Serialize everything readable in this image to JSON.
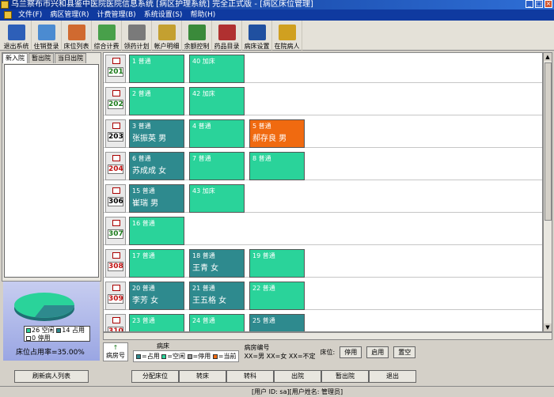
{
  "window": {
    "title": "乌兰察布市兴和县鉴中医院医院信息系统 [病区护理系统] 完全正式版 - [病区床位管理]"
  },
  "menu": {
    "items": [
      "文件(F)",
      "病区管理(R)",
      "计费管理(B)",
      "系统设置(S)",
      "帮助(H)"
    ]
  },
  "toolbar": {
    "items": [
      {
        "label": "退出系统",
        "icon": "exit-icon",
        "color": "#2d5fb8"
      },
      {
        "label": "住销登录",
        "icon": "login-icon",
        "color": "#4b8bd1"
      },
      {
        "label": "床位列表",
        "icon": "users-icon",
        "color": "#d06a30"
      },
      {
        "label": "综合计费",
        "icon": "chart-icon",
        "color": "#48a04a"
      },
      {
        "label": "领药计划",
        "icon": "clipboard-icon",
        "color": "#7a7a7a"
      },
      {
        "label": "帐户明细",
        "icon": "magnifier-icon",
        "color": "#c4a030"
      },
      {
        "label": "余额控制",
        "icon": "checklist-icon",
        "color": "#3a8a3a"
      },
      {
        "label": "药品目录",
        "icon": "books-icon",
        "color": "#b03030"
      },
      {
        "label": "病床设置",
        "icon": "monitor-icon",
        "color": "#2050a0"
      },
      {
        "label": "在院病人",
        "icon": "bars-icon",
        "color": "#d0a020"
      }
    ]
  },
  "leftpanel": {
    "tabs": [
      "新入院",
      "暂出院",
      "当日出院"
    ],
    "legend": {
      "empty": "26 空闲",
      "occupied": "14 占用",
      "disabled": "0 停用"
    },
    "rate_label": "床位占用率=35.00%"
  },
  "colors": {
    "occupied": "#2e8a8e",
    "empty": "#2ad39a",
    "current": "#f06a10",
    "disabled": "#9a9a9a"
  },
  "rooms": [
    {
      "num": "201",
      "num_color": "#1a7a1a",
      "beds": [
        {
          "no": "1 普通",
          "name": "",
          "status": "empty"
        },
        {
          "no": "40 加床",
          "name": "",
          "status": "empty"
        }
      ]
    },
    {
      "num": "202",
      "num_color": "#1a7a1a",
      "beds": [
        {
          "no": "2 普通",
          "name": "",
          "status": "empty"
        },
        {
          "no": "42 加床",
          "name": "",
          "status": "empty"
        }
      ]
    },
    {
      "num": "203",
      "num_color": "#000000",
      "beds": [
        {
          "no": "3 普通",
          "name": "张振英 男",
          "status": "occupied"
        },
        {
          "no": "4 普通",
          "name": "",
          "status": "empty"
        },
        {
          "no": "5 普通",
          "name": "郝存良 男",
          "status": "current"
        }
      ]
    },
    {
      "num": "204",
      "num_color": "#c01010",
      "beds": [
        {
          "no": "6 普通",
          "name": "苏成成 女",
          "status": "occupied"
        },
        {
          "no": "7 普通",
          "name": "",
          "status": "empty"
        },
        {
          "no": "8 普通",
          "name": "",
          "status": "empty"
        }
      ]
    },
    {
      "num": "306",
      "num_color": "#000000",
      "beds": [
        {
          "no": "15 普通",
          "name": "崔瑞 男",
          "status": "occupied"
        },
        {
          "no": "43 加床",
          "name": "",
          "status": "empty"
        }
      ]
    },
    {
      "num": "307",
      "num_color": "#1a7a1a",
      "beds": [
        {
          "no": "16 普通",
          "name": "",
          "status": "empty"
        }
      ]
    },
    {
      "num": "308",
      "num_color": "#c01010",
      "beds": [
        {
          "no": "17 普通",
          "name": "",
          "status": "empty"
        },
        {
          "no": "18 普通",
          "name": "王青 女",
          "status": "occupied"
        },
        {
          "no": "19 普通",
          "name": "",
          "status": "empty"
        }
      ]
    },
    {
      "num": "309",
      "num_color": "#c01010",
      "beds": [
        {
          "no": "20 普通",
          "name": "李芳 女",
          "status": "occupied"
        },
        {
          "no": "21 普通",
          "name": "王五格 女",
          "status": "occupied"
        },
        {
          "no": "22 普通",
          "name": "",
          "status": "empty"
        }
      ]
    },
    {
      "num": "310",
      "num_color": "#c01010",
      "beds": [
        {
          "no": "23 普通",
          "name": "",
          "status": "empty"
        },
        {
          "no": "24 普通",
          "name": "",
          "status": "empty"
        },
        {
          "no": "25 普通",
          "name": "",
          "status": "occupied"
        }
      ]
    }
  ],
  "legendbar": {
    "room_label": "病房号",
    "ward_title": "病床",
    "ward_items": [
      "=占用",
      "=空闲",
      "=停用",
      "=当前"
    ],
    "code_title": "病房编号",
    "code_desc": "XX=男 XX=女 XX=不定",
    "bed_label": "床位:",
    "stop": "停用",
    "enable": "启用",
    "clear": "置空"
  },
  "bottom": {
    "refresh": "刷新病人列表",
    "assign": "分配床位",
    "transfer_bed": "转床",
    "transfer_dept": "转科",
    "discharge": "出院",
    "temp_discharge": "暂出院",
    "exit": "退出"
  },
  "status": "[用户 ID: sa][用户姓名: 管理员]"
}
